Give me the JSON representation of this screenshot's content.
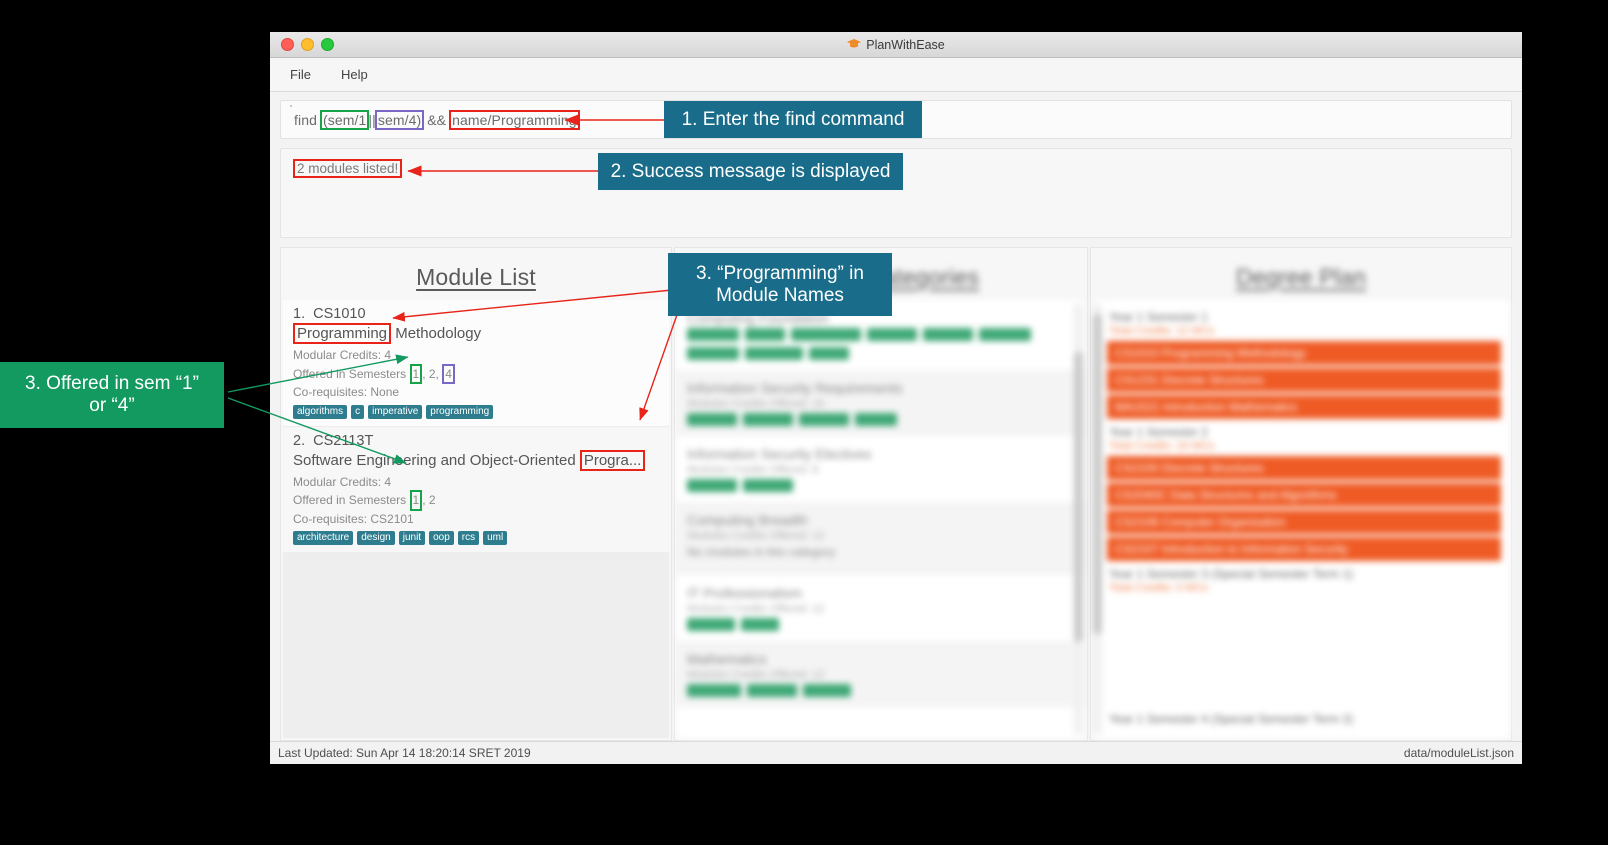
{
  "window": {
    "title": "PlanWithEase",
    "icon": "graduation-cap-icon",
    "menu": [
      "File",
      "Help"
    ]
  },
  "command": {
    "prefix": "find ",
    "paren_open": "(",
    "seg_sem1": "sem/1",
    "or_op": "||",
    "seg_sem4": "sem/4",
    "paren_close": ")",
    "and_op": " && ",
    "seg_name": "name/Programming",
    "full": "find (sem/1 || sem/4) && name/Programming"
  },
  "result": {
    "message": "2 modules listed!"
  },
  "panels": {
    "left": {
      "title": "Module List",
      "modules": [
        {
          "index": "1.",
          "code": "CS1010",
          "name_highlight": "Programming",
          "name_rest": " Methodology",
          "credits_label": "Modular Credits: 4",
          "semesters_label": "Offered in Semesters ",
          "sem_1": "1",
          "sem_sep1": ", 2, ",
          "sem_4": "4",
          "coreq_label": "Co-requisites: None",
          "tags": [
            "algorithms",
            "c",
            "imperative",
            "programming"
          ]
        },
        {
          "index": "2.",
          "code": "CS2113T",
          "name_prefix": "Software Engineering and Object-Oriented ",
          "name_highlight": "Progra...",
          "credits_label": "Modular Credits: 4",
          "semesters_label": "Offered in Semesters ",
          "sem_1": "1",
          "sem_sep1": ", 2",
          "coreq_label": "Co-requisites: CS2101",
          "tags": [
            "architecture",
            "design",
            "junit",
            "oop",
            "rcs",
            "uml"
          ]
        }
      ]
    },
    "middle": {
      "title": "Module Categories",
      "categories": [
        {
          "title": "Computing Foundation",
          "sub": "",
          "tag_widths": [
            52,
            40,
            70,
            50,
            50,
            52,
            52,
            58,
            40
          ]
        },
        {
          "title": "Information Security Requirements",
          "sub": "Modules Credits Offered: 16",
          "tag_widths": [
            50,
            50,
            50,
            42
          ]
        },
        {
          "title": "Information Security Electives",
          "sub": "Modules Credits Offered: 8",
          "tag_widths": [
            50,
            50
          ]
        },
        {
          "title": "Computing Breadth",
          "sub": "Modules Credits Offered: 12",
          "note": "No modules in this category",
          "tag_widths": []
        },
        {
          "title": "IT Professionalism",
          "sub": "Modules Credits Offered: 12",
          "tag_widths": [
            48,
            38
          ]
        },
        {
          "title": "Mathematics",
          "sub": "Modules Credits Offered: 12",
          "tag_widths": [
            54,
            50,
            48
          ]
        }
      ]
    },
    "right": {
      "title": "Degree Plan",
      "groups": [
        {
          "header": "Year 1 Semester 1",
          "sub": "Total Credits: 12 MCs",
          "rows": [
            "CS1010 Programming Methodology",
            "CS1231 Discrete Structures",
            "MA1521 Introduction Mathematics"
          ]
        },
        {
          "header": "Year 1 Semester 2",
          "sub": "Total Credits: 16 MCs",
          "rows": [
            "CS2100 Discrete Structures",
            "CS2040C Data Structures and Algorithms",
            "CS2106 Computer Organisation",
            "CS2107 Introduction to Information Security"
          ]
        },
        {
          "header": "Year 1 Semester 3 (Special Semester Term 1)",
          "sub": "Total Credits: 0 MCs",
          "rows": []
        },
        {
          "header": "Year 1 Semester 4 (Special Semester Term 2)",
          "sub": "",
          "rows": []
        }
      ]
    }
  },
  "statusbar": {
    "left": "Last Updated: Sun Apr 14 18:20:14 SRET 2019",
    "right": "data/moduleList.json"
  },
  "annotations": {
    "step1": "1. Enter the find command",
    "step2": "2. Success message is displayed",
    "step3_names_line1": "3. “Programming” in",
    "step3_names_line2": "Module Names",
    "step3_sem_line1": "3. Offered in sem “1”",
    "step3_sem_line2": "or “4”"
  },
  "colors": {
    "teal": "#1a6d8a",
    "green": "#139a60",
    "red": "#e8241a",
    "purple": "#7b68c4",
    "tag_teal": "#2e7d8f",
    "orange": "#ef5b25"
  }
}
